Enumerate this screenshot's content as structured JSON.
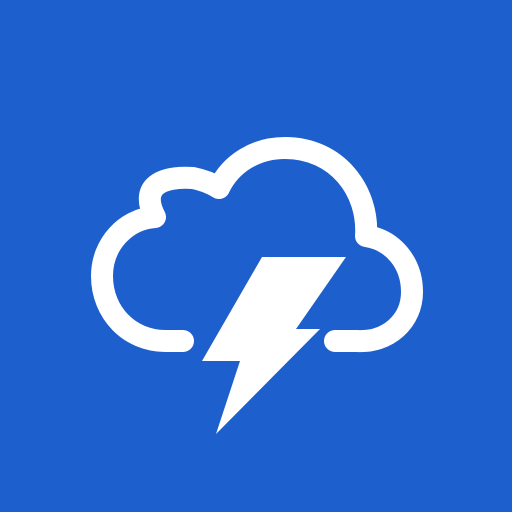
{
  "app": {
    "background_color": "#1D5FCC",
    "icon": {
      "name": "thunderstorm-icon",
      "color": "#FFFFFF",
      "parts": [
        "cloud-outline",
        "lightning-bolt"
      ]
    }
  }
}
